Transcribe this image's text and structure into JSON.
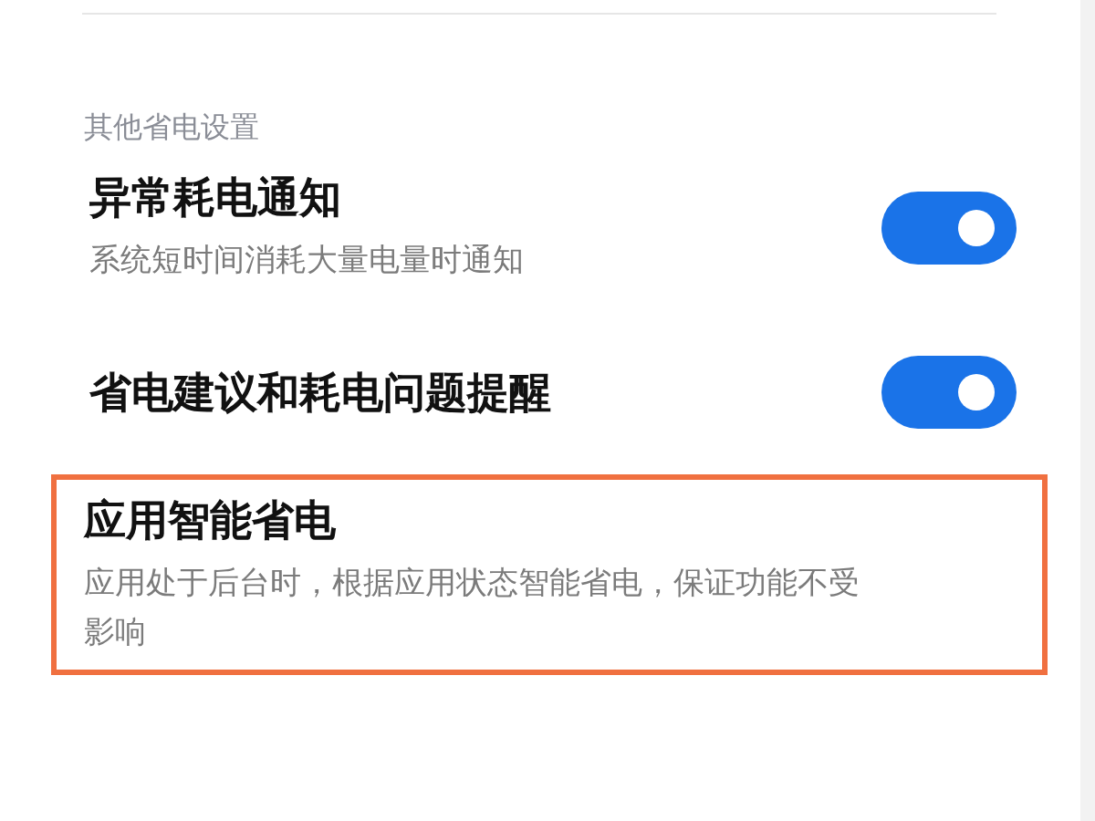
{
  "section_title": "其他省电设置",
  "settings": [
    {
      "title": "异常耗电通知",
      "description": "系统短时间消耗大量电量时通知",
      "on": true,
      "highlighted": false
    },
    {
      "title": "省电建议和耗电问题提醒",
      "on": true,
      "highlighted": false
    },
    {
      "title": "应用智能省电",
      "description": "应用处于后台时，根据应用状态智能省电，保证功能不受影响",
      "highlighted": true
    }
  ]
}
